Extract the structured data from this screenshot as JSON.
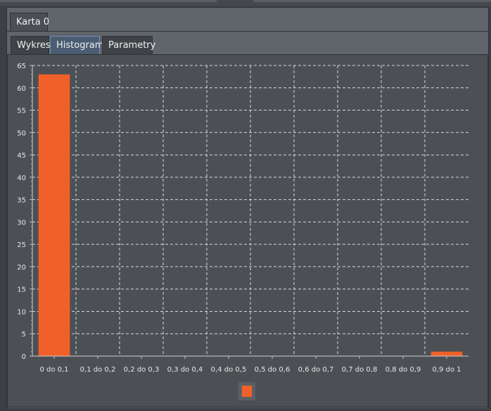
{
  "outer_tabs": [
    {
      "label": "Karta 0"
    }
  ],
  "inner_tabs": [
    {
      "label": "Wykres",
      "active": false
    },
    {
      "label": "Histogram",
      "active": true
    },
    {
      "label": "Parametry",
      "active": false
    }
  ],
  "colors": {
    "bar": "#f16028",
    "grid": "#d8d8d8",
    "panel": "#4c5055"
  },
  "chart_data": {
    "type": "bar",
    "categories": [
      "0 do 0,1",
      "0,1 do 0,2",
      "0,2 do 0,3",
      "0,3 do 0,4",
      "0,4 do 0,5",
      "0,5 do 0,6",
      "0,6 do 0,7",
      "0,7 do 0,8",
      "0,8 do 0,9",
      "0,9 do 1"
    ],
    "values": [
      63,
      0,
      0,
      0,
      0,
      0,
      0,
      0,
      0,
      1
    ],
    "ylim": [
      0,
      65
    ],
    "yticks": [
      0,
      5,
      10,
      15,
      20,
      25,
      30,
      35,
      40,
      45,
      50,
      55,
      60,
      65
    ],
    "grid": true,
    "legend": "bottom-center"
  }
}
